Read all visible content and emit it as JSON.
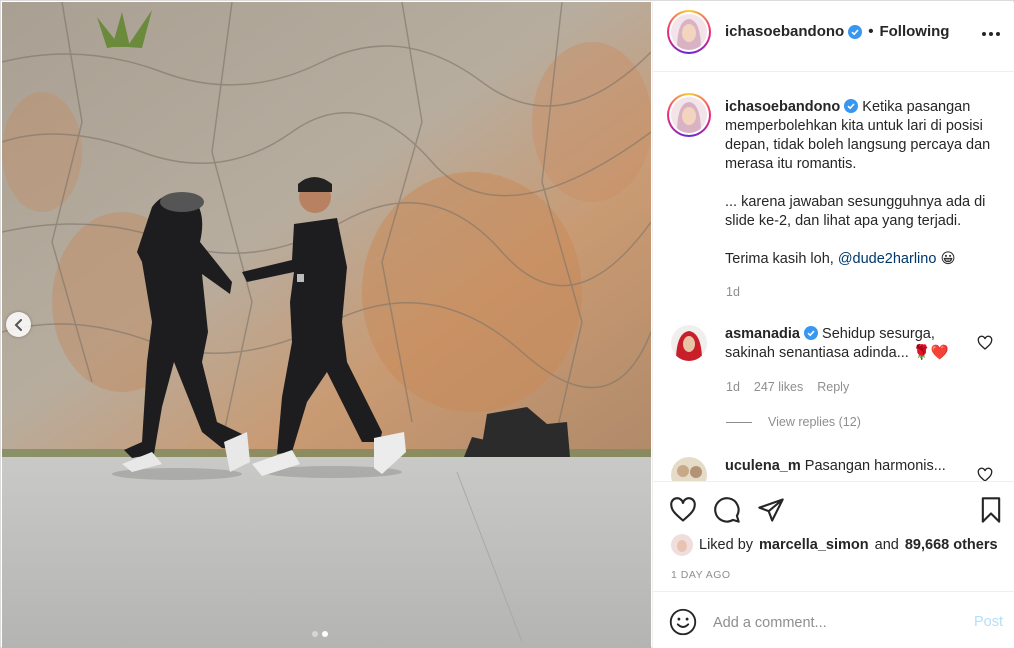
{
  "post": {
    "username": "ichasoebandono",
    "separator": "•",
    "follow_status": "Following",
    "carousel": {
      "total_slides": 2,
      "current_slide": 2
    }
  },
  "caption": {
    "username": "ichasoebandono",
    "paragraph1": "Ketika pasangan memperbolehkan kita untuk lari di posisi depan, tidak boleh langsung percaya dan merasa itu romantis.",
    "paragraph2": "... karena jawaban sesungguhnya ada di slide ke-2, dan lihat apa yang terjadi.",
    "paragraph3_prefix": "Terima kasih loh, ",
    "mention": "@dude2harlino",
    "emoji": "😀",
    "time": "1d"
  },
  "comments": [
    {
      "username": "asmanadia",
      "text": "Sehidup sesurga, sakinah senantiasa adinda... 🌹❤️",
      "time": "1d",
      "likes": "247 likes",
      "reply_label": "Reply",
      "view_replies": "View replies (12)"
    },
    {
      "username": "uculena_m",
      "text": "Pasangan harmonis..."
    }
  ],
  "actions": {
    "liked_by_prefix": "Liked by",
    "liked_by_user": "marcella_simon",
    "and": "and",
    "others": "89,668 others",
    "date": "1 DAY AGO"
  },
  "add_comment": {
    "placeholder": "Add a comment...",
    "post_label": "Post"
  },
  "colors": {
    "verified": "#3897f0",
    "link": "#00376b",
    "muted": "#8e8e8e",
    "post_disabled": "#b2dffc"
  },
  "icons": [
    "chevron-left-icon",
    "verified-icon",
    "more-icon",
    "heart-icon",
    "comment-icon",
    "share-icon",
    "bookmark-icon",
    "emoji-icon"
  ]
}
